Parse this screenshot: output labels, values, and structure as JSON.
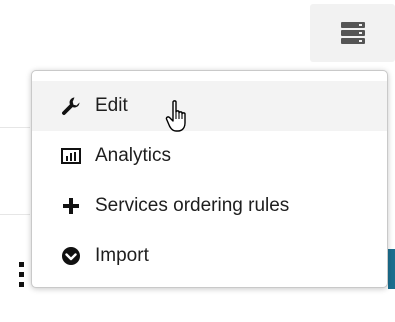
{
  "toolbar": {
    "menu_icon": "server-stack-icon"
  },
  "dropdown": {
    "items": [
      {
        "label": "Edit",
        "icon": "wrench-icon"
      },
      {
        "label": "Analytics",
        "icon": "bar-chart-icon"
      },
      {
        "label": "Services ordering rules",
        "icon": "plus-icon"
      },
      {
        "label": "Import",
        "icon": "circle-arrow-down-icon"
      }
    ]
  },
  "colors": {
    "accent_teal": "#1c6f8f",
    "menu_hover": "#f3f3f3",
    "text": "#1e1e1e"
  }
}
